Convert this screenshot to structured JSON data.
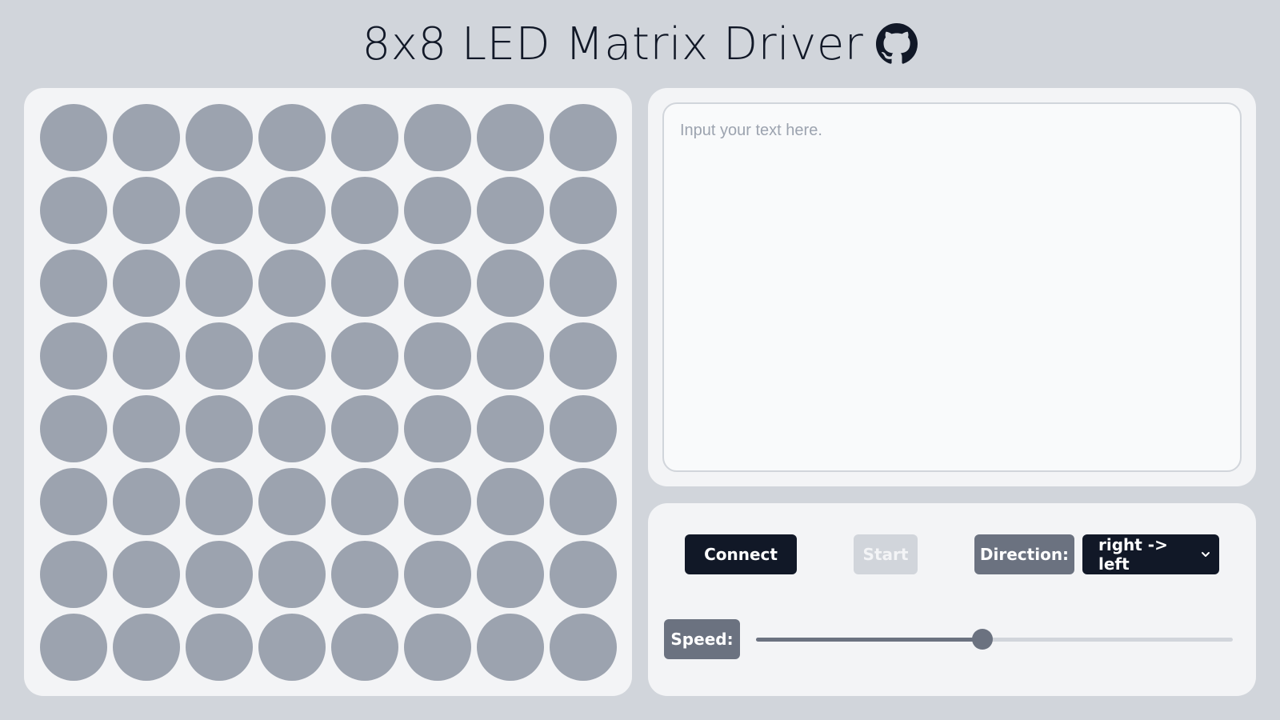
{
  "header": {
    "title": "8x8 LED Matrix Driver",
    "github_icon": "github-icon"
  },
  "matrix": {
    "rows": 8,
    "cols": 8,
    "off_color": "#9ca3af",
    "on_color": "#ef4444",
    "states": [
      [
        0,
        0,
        0,
        0,
        0,
        0,
        0,
        0
      ],
      [
        0,
        0,
        0,
        0,
        0,
        0,
        0,
        0
      ],
      [
        0,
        0,
        0,
        0,
        0,
        0,
        0,
        0
      ],
      [
        0,
        0,
        0,
        0,
        0,
        0,
        0,
        0
      ],
      [
        0,
        0,
        0,
        0,
        0,
        0,
        0,
        0
      ],
      [
        0,
        0,
        0,
        0,
        0,
        0,
        0,
        0
      ],
      [
        0,
        0,
        0,
        0,
        0,
        0,
        0,
        0
      ],
      [
        0,
        0,
        0,
        0,
        0,
        0,
        0,
        0
      ]
    ]
  },
  "text_input": {
    "value": "",
    "placeholder": "Input your text here."
  },
  "controls": {
    "connect_label": "Connect",
    "start_label": "Start",
    "start_disabled": true,
    "direction_label": "Direction:",
    "direction_value": "right -> left",
    "speed_label": "Speed:",
    "speed_fraction": 0.475
  },
  "colors": {
    "background": "#d1d5db",
    "panel": "#f3f4f6",
    "primary_button": "#111827",
    "tag": "#6b7280",
    "disabled_button": "#d1d5db"
  }
}
